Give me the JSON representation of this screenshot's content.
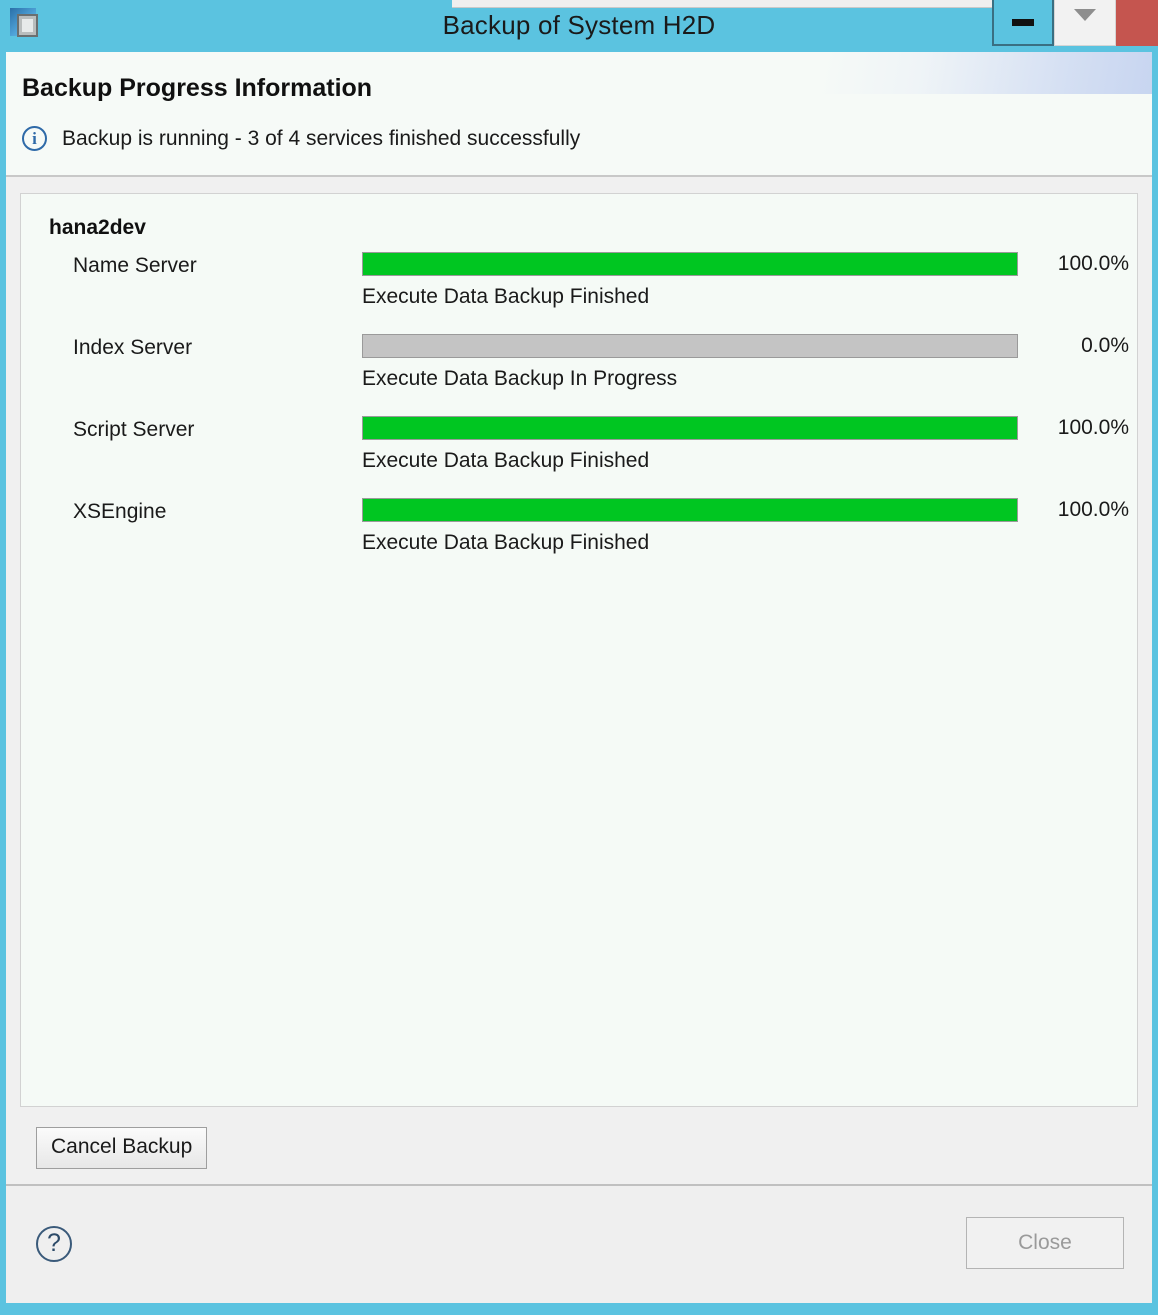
{
  "window": {
    "title": "Backup of System H2D",
    "app_icon": "chip-icon",
    "controls": {
      "minimize": "minimize-icon",
      "restore": "chevron-down-icon",
      "close": "close-icon"
    },
    "frame_color": "#5bc3e0"
  },
  "header": {
    "title": "Backup Progress Information",
    "status_icon": "info-icon",
    "status_glyph": "i",
    "status_text": "Backup is running - 3 of 4 services finished successfully"
  },
  "content": {
    "host": "hana2dev",
    "services": [
      {
        "name": "Name Server",
        "percent_label": "100.0%",
        "percent_value": 100,
        "status": "Execute Data Backup Finished",
        "bar_color": "#00c621"
      },
      {
        "name": "Index Server",
        "percent_label": "0.0%",
        "percent_value": 0,
        "status": "Execute Data Backup In Progress",
        "bar_color": "#00c621"
      },
      {
        "name": "Script Server",
        "percent_label": "100.0%",
        "percent_value": 100,
        "status": "Execute Data Backup Finished",
        "bar_color": "#00c621"
      },
      {
        "name": "XSEngine",
        "percent_label": "100.0%",
        "percent_value": 100,
        "status": "Execute Data Backup Finished",
        "bar_color": "#00c621"
      }
    ]
  },
  "actions": {
    "cancel_backup": "Cancel Backup"
  },
  "footer": {
    "help_icon": "question-mark-icon",
    "help_glyph": "?",
    "close_label": "Close",
    "close_enabled": false
  }
}
